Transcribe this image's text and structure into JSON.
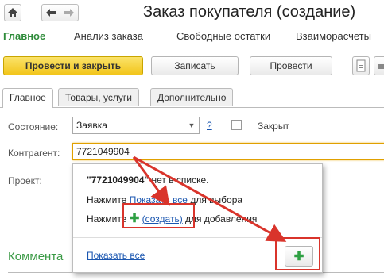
{
  "window": {
    "title": "Заказ покупателя (создание)"
  },
  "nav": {
    "home_icon": "home-icon",
    "back_icon": "arrow-left-icon",
    "forward_icon": "arrow-right-icon"
  },
  "top_tabs": [
    "Главное",
    "Анализ заказа",
    "Свободные остатки",
    "Взаиморасчеты"
  ],
  "toolbar": {
    "post_close": "Провести и закрыть",
    "save": "Записать",
    "post": "Провести"
  },
  "form_tabs": [
    "Главное",
    "Товары, услуги",
    "Дополнительно"
  ],
  "fields": {
    "status_label": "Состояние:",
    "status_value": "Заявка",
    "help": "?",
    "closed_label": "Закрыт",
    "contractor_label": "Контрагент:",
    "contractor_value": "7721049904",
    "project_label": "Проект:"
  },
  "popup": {
    "quote_value": "\"7721049904\"",
    "line1_tail": "нет в списке.",
    "line2_prefix": "Нажмите",
    "line2_link": "Показать все",
    "line2_tail": "для выбора",
    "line3_prefix": "Нажмите",
    "line3_link": "(создать)",
    "line3_tail": "для добавления",
    "show_all": "Показать все"
  },
  "section": {
    "comment": "Коммента"
  },
  "colors": {
    "accent_green": "#2e8b3a",
    "primary_yellow": "#f2c51a",
    "annotation_red": "#d9342b",
    "link_blue": "#1a56b0"
  }
}
